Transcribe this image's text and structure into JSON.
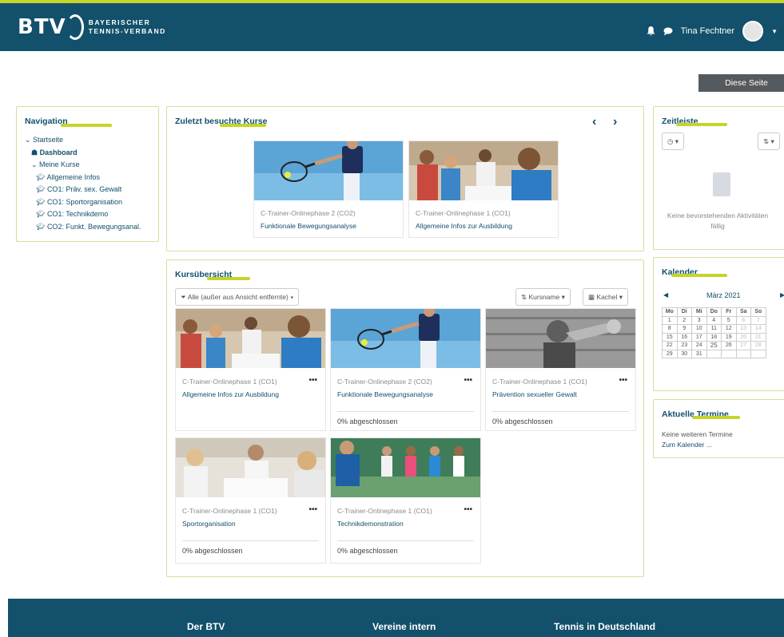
{
  "header": {
    "logo_btv": "BTV",
    "logo_line1": "BAYERISCHER",
    "logo_line2": "TENNIS-VERBAND",
    "user_name": "Tina Fechtner"
  },
  "edit_button": "Diese Seite bearbeiten",
  "navigation": {
    "title": "Navigation",
    "items": [
      "Startseite",
      "Dashboard",
      "Meine Kurse",
      "Allgemeine Infos",
      "CO1: Präv. sex. Gewalt",
      "CO1: Sportorganisation",
      "CO1: Technikdemo",
      "CO2: Funkt. Bewegungsanal."
    ]
  },
  "recent": {
    "title": "Zuletzt besuchte Kurse",
    "courses": [
      {
        "category": "C-Trainer-Onlinephase 2 (CO2)",
        "name": "Funktionale Bewegungsanalyse"
      },
      {
        "category": "C-Trainer-Onlinephase 1 (CO1)",
        "name": "Allgemeine Infos zur Ausbildung"
      }
    ]
  },
  "overview": {
    "title": "Kursübersicht",
    "filter": "Alle (außer aus Ansicht entfernte)",
    "sort": "Kursname",
    "view": "Kachel",
    "courses": [
      {
        "category": "C-Trainer-Onlinephase 1 (CO1)",
        "name": "Allgemeine Infos zur Ausbildung",
        "progress": ""
      },
      {
        "category": "C-Trainer-Onlinephase 2 (CO2)",
        "name": "Funktionale Bewegungsanalyse",
        "progress": "0% abgeschlossen"
      },
      {
        "category": "C-Trainer-Onlinephase 1 (CO1)",
        "name": "Prävention sexueller Gewalt",
        "progress": "0% abgeschlossen"
      },
      {
        "category": "C-Trainer-Onlinephase 1 (CO1)",
        "name": "Sportorganisation",
        "progress": "0% abgeschlossen"
      },
      {
        "category": "C-Trainer-Onlinephase 1 (CO1)",
        "name": "Technikdemonstration",
        "progress": "0% abgeschlossen"
      }
    ],
    "dots": "•••"
  },
  "timeline": {
    "title": "Zeitleiste",
    "empty_line1": "Keine bevorstehenden Aktivitäten",
    "empty_line2": "fällig"
  },
  "calendar": {
    "title": "Kalender",
    "month": "März 2021",
    "weekdays": [
      "Mo",
      "Di",
      "Mi",
      "Do",
      "Fr",
      "Sa",
      "So"
    ],
    "weeks": [
      [
        "1",
        "2",
        "3",
        "4",
        "5",
        "6",
        "7"
      ],
      [
        "8",
        "9",
        "10",
        "11",
        "12",
        "13",
        "14"
      ],
      [
        "15",
        "16",
        "17",
        "18",
        "19",
        "20",
        "21"
      ],
      [
        "22",
        "23",
        "24",
        "25",
        "26",
        "27",
        "28"
      ],
      [
        "29",
        "30",
        "31",
        "",
        "",
        "",
        ""
      ]
    ]
  },
  "events": {
    "title": "Aktuelle Termine",
    "none": "Keine weiteren Termine",
    "link": "Zum Kalender ..."
  },
  "footer": {
    "col1": "Der BTV",
    "col2": "Vereine intern",
    "col3": "Tennis in Deutschland"
  },
  "colors": {
    "primary": "#12506b",
    "accent": "#c7d32a"
  }
}
